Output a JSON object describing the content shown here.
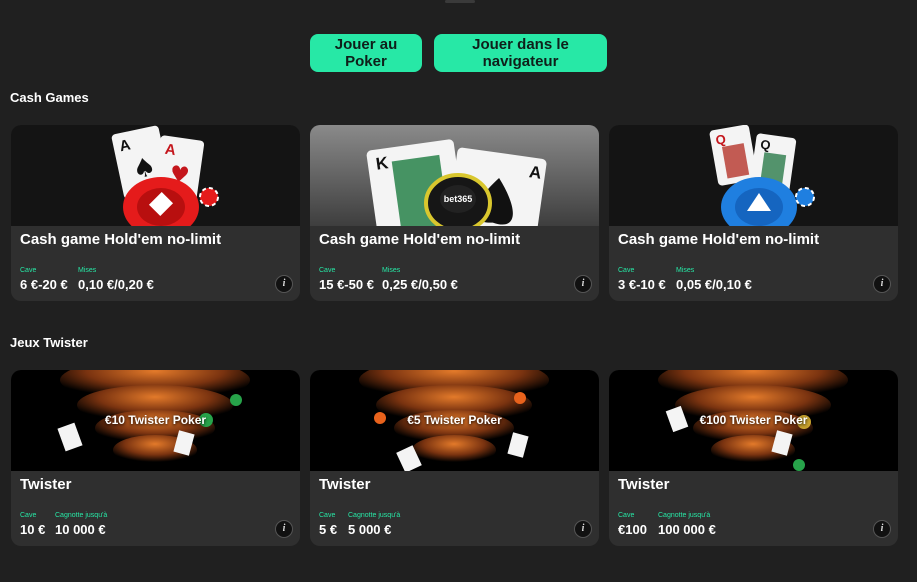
{
  "actions": {
    "play_poker": "Jouer au Poker",
    "play_browser": "Jouer dans le navigateur"
  },
  "sections": {
    "cash": {
      "title": "Cash Games",
      "cards": [
        {
          "title": "Cash game Hold'em no-limit",
          "buyin_label": "Cave",
          "buyin": "6 €-20 €",
          "stakes_label": "Mises",
          "stakes": "0,10 €/0,20 €",
          "theme": "dark-red-chips"
        },
        {
          "title": "Cash game Hold'em no-limit",
          "buyin_label": "Cave",
          "buyin": "15 €-50 €",
          "stakes_label": "Mises",
          "stakes": "0,25 €/0,50 €",
          "theme": "grey-bet365-chip",
          "chip_text": "bet365"
        },
        {
          "title": "Cash game Hold'em no-limit",
          "buyin_label": "Cave",
          "buyin": "3 €-10 €",
          "stakes_label": "Mises",
          "stakes": "0,05 €/0,10 €",
          "theme": "dark-blue-chips"
        }
      ]
    },
    "twister": {
      "title": "Jeux Twister",
      "cards": [
        {
          "title": "Twister",
          "banner": "€10 Twister Poker",
          "buyin_label": "Cave",
          "buyin": "10 €",
          "jackpot_label": "Cagnotte jusqu'à",
          "jackpot": "10 000 €"
        },
        {
          "title": "Twister",
          "banner": "€5 Twister Poker",
          "buyin_label": "Cave",
          "buyin": "5 €",
          "jackpot_label": "Cagnotte jusqu'à",
          "jackpot": "5 000 €"
        },
        {
          "title": "Twister",
          "banner": "€100 Twister Poker",
          "buyin_label": "Cave",
          "buyin": "€100",
          "jackpot_label": "Cagnotte jusqu'à",
          "jackpot": "100 000 €"
        }
      ]
    }
  },
  "info_glyph": "i",
  "card_glyphs": {
    "ace": "A",
    "spade": "♠",
    "heart": "♥",
    "king": "K",
    "queen": "Q"
  },
  "colors": {
    "accent": "#27e8a6",
    "background": "#202020",
    "card": "#2f2f2f"
  }
}
